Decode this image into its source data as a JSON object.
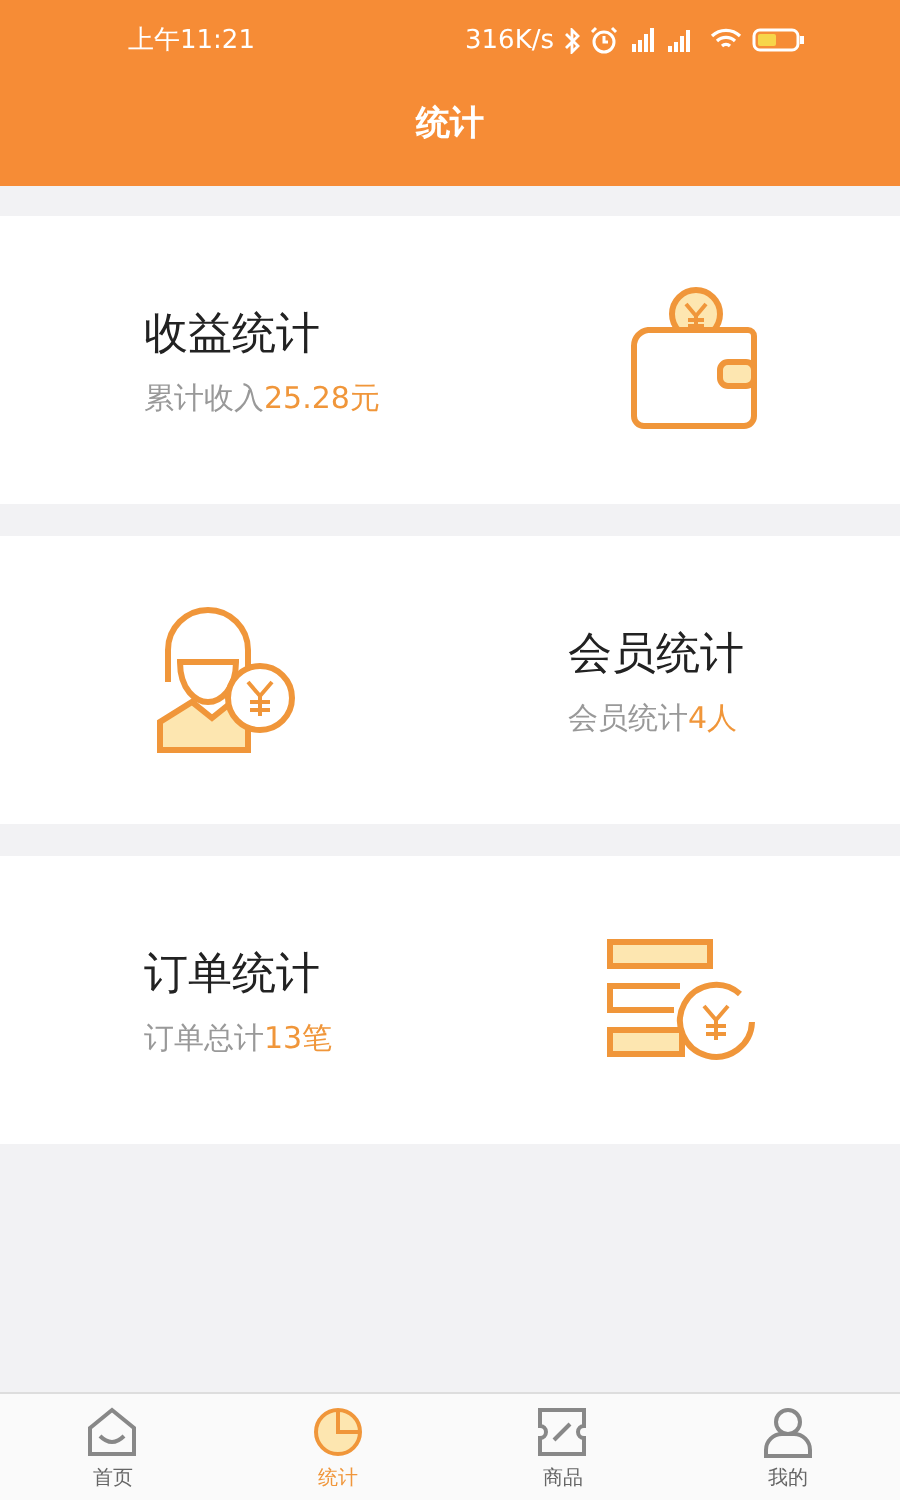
{
  "status_bar": {
    "time": "上午11:21",
    "speed": "316K/s"
  },
  "header": {
    "title": "统计"
  },
  "cards": [
    {
      "kind": "wallet",
      "icon_left": false,
      "title": "收益统计",
      "label": "累计收入",
      "value": "25.28元"
    },
    {
      "kind": "member",
      "icon_left": true,
      "title": "会员统计",
      "label": "会员统计",
      "value": "4人"
    },
    {
      "kind": "order",
      "icon_left": false,
      "title": "订单统计",
      "label": "订单总计",
      "value": "13笔"
    }
  ],
  "tabs": [
    {
      "kind": "home",
      "label": "首页",
      "selected": false
    },
    {
      "kind": "stats",
      "label": "统计",
      "selected": true
    },
    {
      "kind": "goods",
      "label": "商品",
      "selected": false
    },
    {
      "kind": "me",
      "label": "我的",
      "selected": false
    }
  ]
}
